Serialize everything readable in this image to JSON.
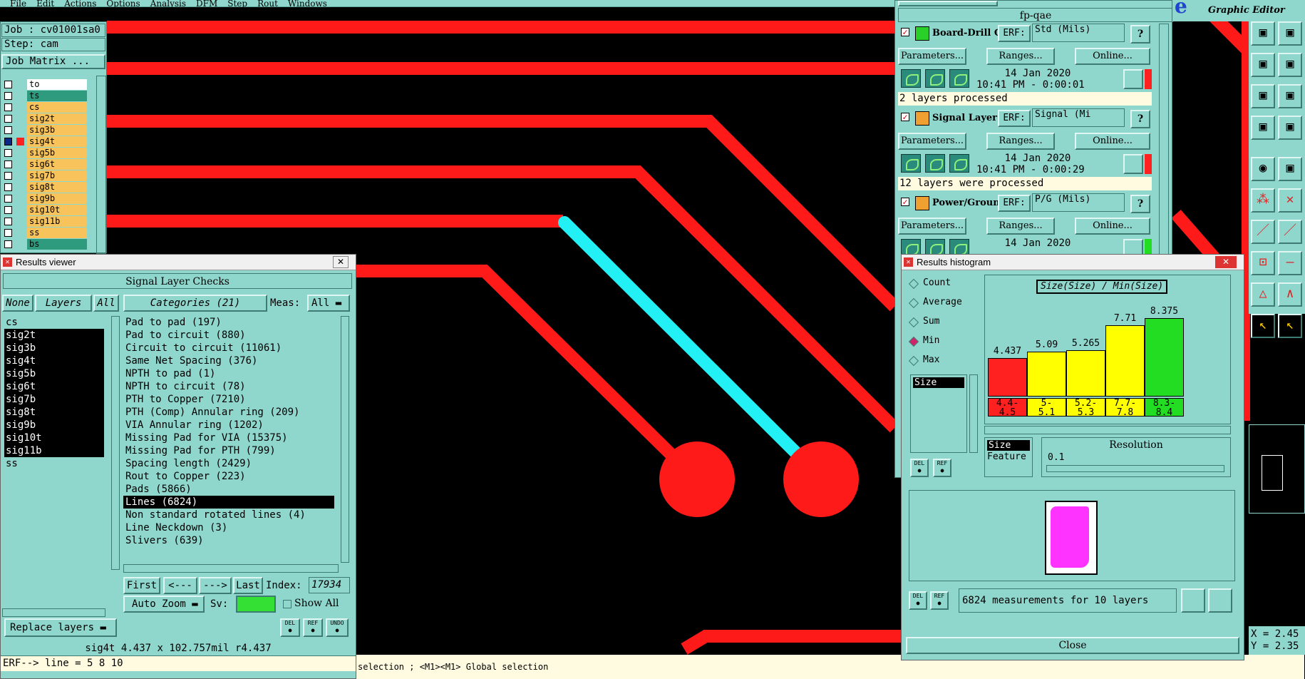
{
  "menu": [
    "File",
    "Edit",
    "Actions",
    "Options",
    "Analysis",
    "DFM",
    "Step",
    "Rout",
    "Windows"
  ],
  "job": {
    "job": "Job : cv01001sa0",
    "step": "Step: cam",
    "matrix": "Job Matrix ..."
  },
  "layers": [
    {
      "name": "to",
      "color": "#ffffff"
    },
    {
      "name": "ts",
      "color": "#2e9b7e"
    },
    {
      "name": "cs",
      "color": "#f9c35b"
    },
    {
      "name": "sig2t",
      "color": "#f9c35b"
    },
    {
      "name": "sig3b",
      "color": "#f9c35b"
    },
    {
      "name": "sig4t",
      "color": "#f9c35b"
    },
    {
      "name": "sig5b",
      "color": "#f9c35b"
    },
    {
      "name": "sig6t",
      "color": "#f9c35b"
    },
    {
      "name": "sig7b",
      "color": "#f9c35b"
    },
    {
      "name": "sig8t",
      "color": "#f9c35b"
    },
    {
      "name": "sig9b",
      "color": "#f9c35b"
    },
    {
      "name": "sig10t",
      "color": "#f9c35b"
    },
    {
      "name": "sig11b",
      "color": "#f9c35b"
    },
    {
      "name": "ss",
      "color": "#f9c35b"
    },
    {
      "name": "bs",
      "color": "#2e9b7e"
    }
  ],
  "viewer": {
    "title": "Results viewer",
    "heading": "Signal Layer Checks",
    "none": "None",
    "layers": "Layers",
    "all": "All",
    "categories": "Categories (21)",
    "meas": "Meas:",
    "meas_val": "All",
    "layer_list": [
      "cs",
      "sig2t",
      "sig3b",
      "sig4t",
      "sig5b",
      "sig6t",
      "sig7b",
      "sig8t",
      "sig9b",
      "sig10t",
      "sig11b",
      "ss"
    ],
    "cats": [
      "Pad to pad (197)",
      "Pad to circuit (880)",
      "Circuit to circuit (11061)",
      "Same Net Spacing (376)",
      "NPTH to pad (1)",
      "NPTH to circuit (78)",
      "PTH to Copper (7210)",
      "PTH (Comp) Annular ring (209)",
      "VIA Annular ring (1202)",
      "Missing Pad for VIA (15375)",
      "Missing Pad for PTH (799)",
      "Spacing length (2429)",
      "Rout to Copper (223)",
      "Pads (5866)",
      "Lines (6824)",
      "Non standard rotated lines (4)",
      "Line Neckdown (3)",
      "Slivers (639)"
    ],
    "first": "First",
    "prev": "<---",
    "next": "--->",
    "last": "Last",
    "index_label": "Index:",
    "index": "17934",
    "autozoom": "Auto Zoom",
    "sv": "Sv:",
    "showall": "Show All",
    "replace": "Replace layers",
    "del": "DEL",
    "ref": "REF",
    "undo": "UNDO"
  },
  "status": {
    "info": "sig4t 4.437 x 102.757mil  r4.437",
    "erf": "ERF--> line = 5 8 10",
    "hint": "selection ; <M1><M1> Global selection"
  },
  "qae": {
    "title": "fp-qae",
    "checks": [
      {
        "name": "Board-Drill Che",
        "erf": "ERF:",
        "mode": "Std (Mils)",
        "date": "14 Jan 2020",
        "time": "10:41 PM - 0:00:01",
        "msg": "2 layers processed",
        "led": "#ff2020"
      },
      {
        "name": "Signal Layer Ch",
        "erf": "ERF:",
        "mode": "Signal (Mi",
        "date": "14 Jan 2020",
        "time": "10:41 PM - 0:00:29",
        "msg": "12 layers were processed",
        "led": "#ff2020"
      },
      {
        "name": "Power/Ground C",
        "erf": "ERF:",
        "mode": "P/G (Mils)",
        "date": "14 Jan 2020",
        "time": "",
        "msg": "",
        "led": "#22dd22"
      }
    ],
    "params": "Parameters...",
    "ranges": "Ranges...",
    "online": "Online...",
    "help": "?"
  },
  "histogram": {
    "title": "Results histogram",
    "chart_title": "Size(Size) / Min(Size)",
    "modes": [
      "Count",
      "Average",
      "Sum",
      "Min",
      "Max"
    ],
    "selected_mode": "Min",
    "size": "Size",
    "feature": "Feature",
    "resolution": "Resolution",
    "res_value": "0.1",
    "summary": "6824 measurements for 10 layers",
    "close": "Close",
    "chart_data": {
      "type": "bar",
      "categories": [
        "4.4-\n4.5",
        "5-\n5.1",
        "5.2-\n5.3",
        "7.7-\n7.8",
        "8.3-\n8.4"
      ],
      "values": [
        4.437,
        5.09,
        5.265,
        7.71,
        8.375
      ],
      "labels": [
        "4.437",
        "5.09",
        "5.265",
        "7.71",
        "8.375"
      ],
      "colors": [
        "#ff2020",
        "#ffff00",
        "#ffff00",
        "#ffff00",
        "#22dd22"
      ],
      "title": "Size(Size) / Min(Size)",
      "ylim": [
        0,
        8.375
      ]
    }
  },
  "graphic": {
    "title": "Graphic Editor",
    "logo": "e",
    "x": "X = 2.45",
    "y": "Y = 2.35"
  }
}
